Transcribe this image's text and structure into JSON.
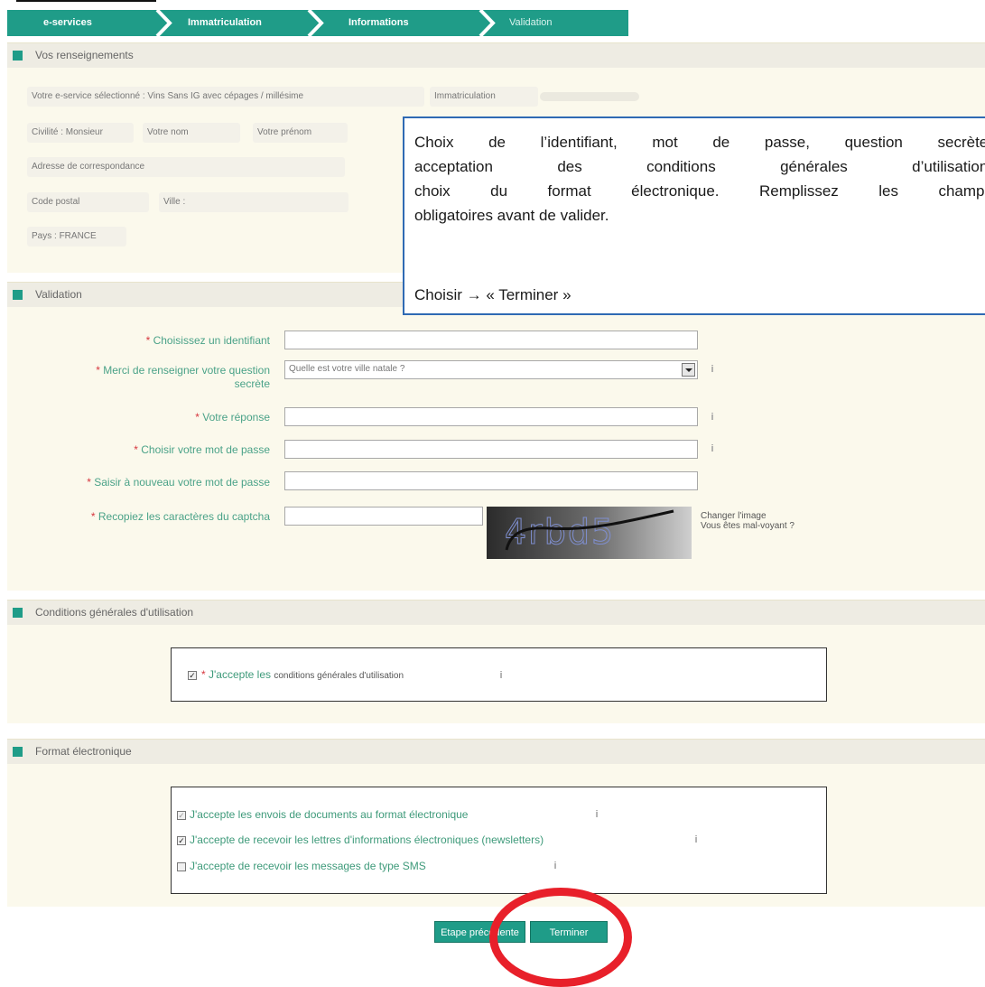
{
  "steps": [
    "e-services",
    "Immatriculation",
    "Informations",
    "Validation"
  ],
  "renseignements": {
    "title": "Vos renseignements",
    "service": "Votre e-service sélectionné : Vins Sans IG avec cépages / millésime",
    "immatriculation": "Immatriculation",
    "civilite": "Civilité : Monsieur",
    "nom": "Votre nom",
    "prenom": "Votre prénom",
    "adresse": "Adresse de correspondance",
    "code_postal": "Code postal",
    "ville": "Ville :",
    "pays": "Pays : FRANCE"
  },
  "callout": {
    "line1": "Choix de l’identifiant, mot de passe, question secrète,",
    "line2": "acceptation des conditions générales d’utilisation,",
    "line3": "choix du format électronique. Remplissez les champs",
    "line4": "obligatoires avant de valider.",
    "line5": "Choisir → « Terminer »"
  },
  "validation": {
    "title": "Validation",
    "identifiant_label": "Choisissez un identifiant",
    "question_label_1": "Merci de renseigner votre question",
    "question_label_2": "secrète",
    "question_value": "Quelle est votre ville natale ?",
    "reponse_label": "Votre réponse",
    "mdp_label": "Choisir votre mot de passe",
    "mdp2_label": "Saisir à nouveau votre mot de passe",
    "captcha_label": "Recopiez les caractères du captcha",
    "captcha_text": "4rbd5",
    "changer_image": "Changer l'image",
    "mal_voyant": "Vous êtes mal-voyant ?",
    "required_mark": "*"
  },
  "cgu": {
    "title": "Conditions générales d'utilisation",
    "accept_prefix": "J'accepte les",
    "accept_link": "conditions générales d'utilisation"
  },
  "format": {
    "title": "Format électronique",
    "opt1": "J'accepte les envois de documents au format électronique",
    "opt2": "J'accepte de recevoir les lettres d'informations électroniques (newsletters)",
    "opt3": "J'accepte de recevoir les messages de type SMS"
  },
  "buttons": {
    "prev": "Etape précédente",
    "finish": "Terminer"
  },
  "colors": {
    "accent": "#1f9c88",
    "required": "#d6353d",
    "callout_border": "#2f6ab3",
    "highlight": "#e8202a"
  },
  "icons": {
    "info": "info-icon",
    "check": "checkbox-icon"
  }
}
